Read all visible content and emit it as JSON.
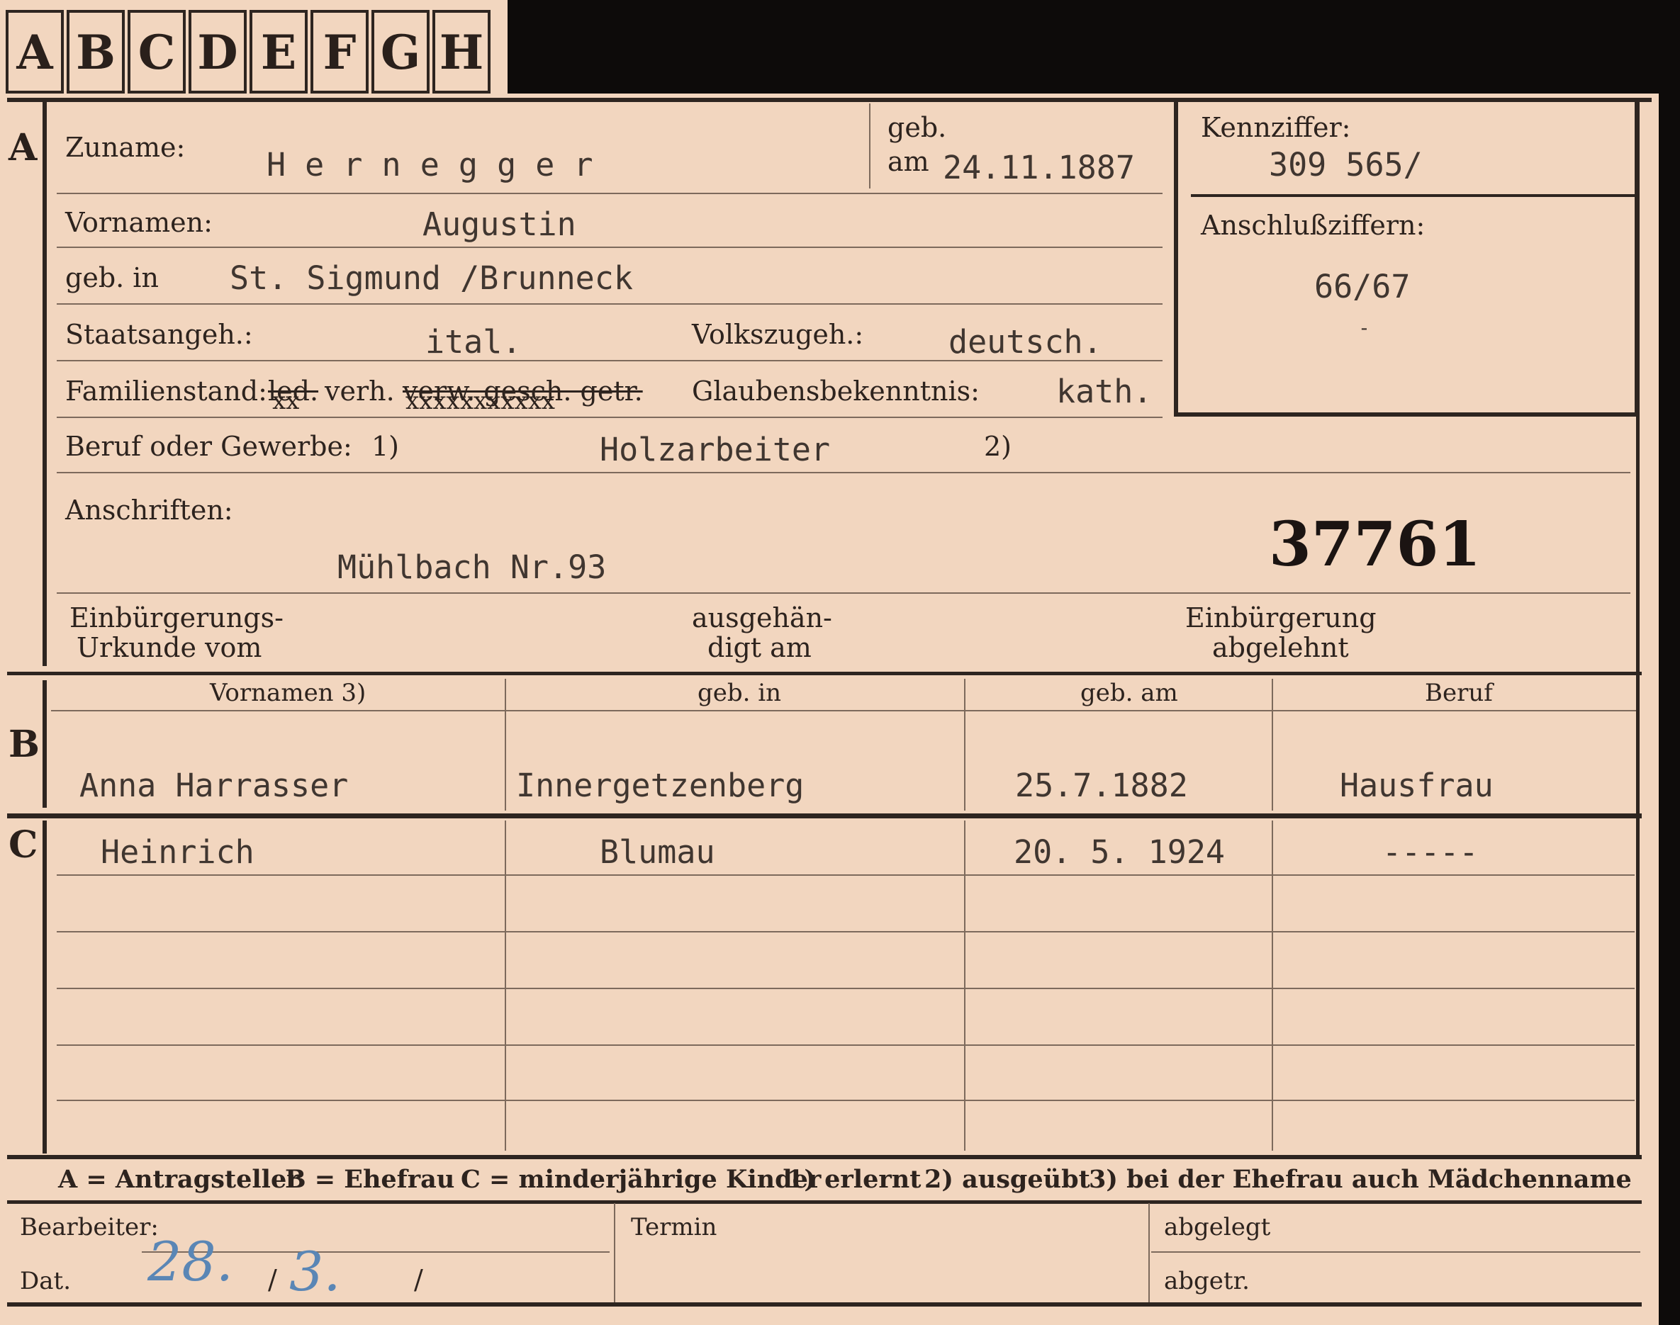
{
  "tabs": [
    "A",
    "B",
    "C",
    "D",
    "E",
    "F",
    "G",
    "H"
  ],
  "section_letters": {
    "a": "A",
    "b": "B",
    "c": "C"
  },
  "a": {
    "zuname_label": "Zuname:",
    "zuname_value": "H e r n e g g e r",
    "geb_label": "geb.",
    "am_label": "am",
    "geb_am_value": "24.11.1887",
    "vornamen_label": "Vornamen:",
    "vornamen_value": "Augustin",
    "geb_in_label": "geb. in",
    "geb_in_value": "St. Sigmund /Brunneck",
    "staatsangeh_label": "Staatsangeh.:",
    "staatsangeh_value": "ital.",
    "volkszugeh_label": "Volkszugeh.:",
    "volkszugeh_value": "deutsch.",
    "familienstand_label": "Familienstand:",
    "fam_led": "led.",
    "fam_verh": "verh.",
    "fam_rest": "verw. gesch. getr.",
    "fam_x1": "xx",
    "fam_x2": "xxxxxxxxxxx",
    "glauben_label": "Glaubensbekenntnis:",
    "glauben_value": "kath.",
    "beruf_label": "Beruf oder Gewerbe:",
    "beruf_sup1": "1)",
    "beruf_value": "Holzarbeiter",
    "beruf_sup2": "2)",
    "anschriften_label": "Anschriften:",
    "anschrift_value": "Mühlbach Nr.93",
    "stamp_number": "37761",
    "einb_urkunde_line1": "Einbürgerungs-",
    "einb_urkunde_line2": "Urkunde vom",
    "ausgehaen_line1": "ausgehän-",
    "ausgehaen_line2": "digt am",
    "einb_abgelehnt_line1": "Einbürgerung",
    "einb_abgelehnt_line2": "abgelehnt"
  },
  "kennziffer": {
    "label": "Kennziffer:",
    "value": "309 565/",
    "anschluss_label": "Anschlußziffern:",
    "anschluss_value": "66/67",
    "dash": "-"
  },
  "b": {
    "headers": [
      "Vornamen 3)",
      "geb. in",
      "geb. am",
      "Beruf"
    ],
    "row": [
      "Anna Harrasser",
      "Innergetzenberg",
      "25.7.1882",
      "Hausfrau"
    ]
  },
  "c": {
    "row": [
      "Heinrich",
      "Blumau",
      "20. 5. 1924",
      "-----"
    ]
  },
  "legend": {
    "a": "A = Antragsteller",
    "b": "B = Ehefrau",
    "c": "C = minderjährige Kinder",
    "n1": "1) erlernt",
    "n2": "2) ausgeübt",
    "n3": "3) bei der Ehefrau auch Mädchenname"
  },
  "footer": {
    "bearbeiter_label": "Bearbeiter:",
    "dat_label": "Dat.",
    "dat_day": "28.",
    "dat_sep1": "/",
    "dat_month": "3.",
    "dat_sep2": "/",
    "termin_label": "Termin",
    "abgelegt_label": "abgelegt",
    "abgetr_label": "abgetr."
  }
}
